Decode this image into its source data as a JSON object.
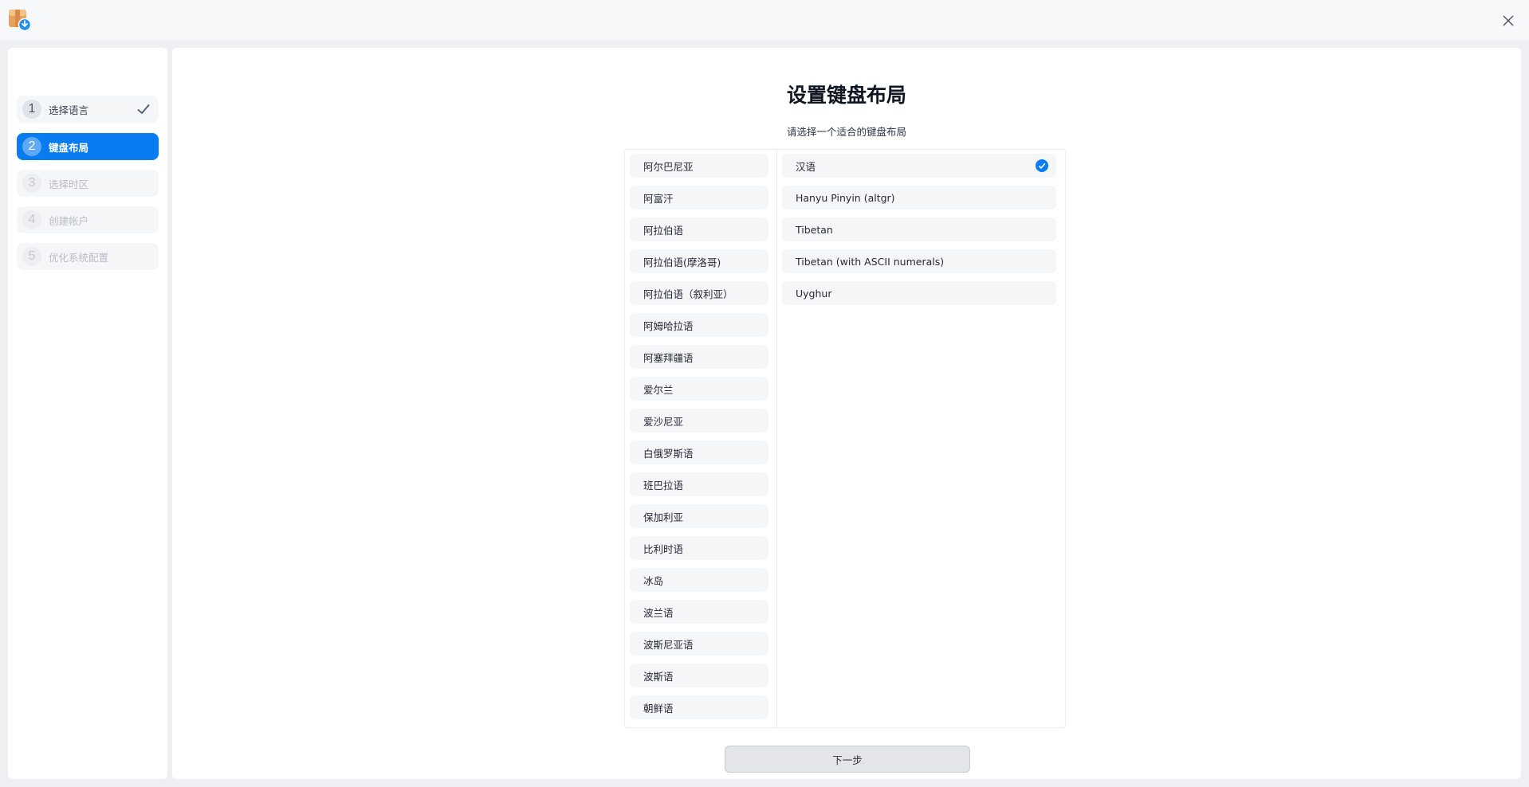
{
  "window": {
    "app_icon": "package-download-icon",
    "close_icon": "close-icon"
  },
  "steps": [
    {
      "num": "1",
      "label": "选择语言",
      "state": "done"
    },
    {
      "num": "2",
      "label": "键盘布局",
      "state": "active"
    },
    {
      "num": "3",
      "label": "选择时区",
      "state": "disabled"
    },
    {
      "num": "4",
      "label": "创建帐户",
      "state": "disabled"
    },
    {
      "num": "5",
      "label": "优化系统配置",
      "state": "disabled"
    }
  ],
  "main": {
    "title": "设置键盘布局",
    "subtitle": "请选择一个适合的键盘布局",
    "next_label": "下一步"
  },
  "layouts": [
    "阿尔巴尼亚",
    "阿富汗",
    "阿拉伯语",
    "阿拉伯语(摩洛哥)",
    "阿拉伯语（叙利亚）",
    "阿姆哈拉语",
    "阿塞拜疆语",
    "爱尔兰",
    "爱沙尼亚",
    "白俄罗斯语",
    "班巴拉语",
    "保加利亚",
    "比利时语",
    "冰岛",
    "波兰语",
    "波斯尼亚语",
    "波斯语",
    "朝鲜语"
  ],
  "variants": [
    {
      "label": "汉语",
      "selected": true
    },
    {
      "label": "Hanyu Pinyin (altgr)",
      "selected": false
    },
    {
      "label": "Tibetan",
      "selected": false
    },
    {
      "label": "Tibetan (with ASCII numerals)",
      "selected": false
    },
    {
      "label": "Uyghur",
      "selected": false
    }
  ],
  "colors": {
    "accent": "#0a7cf2",
    "background": "#eef0f3",
    "panel": "#ffffff"
  }
}
